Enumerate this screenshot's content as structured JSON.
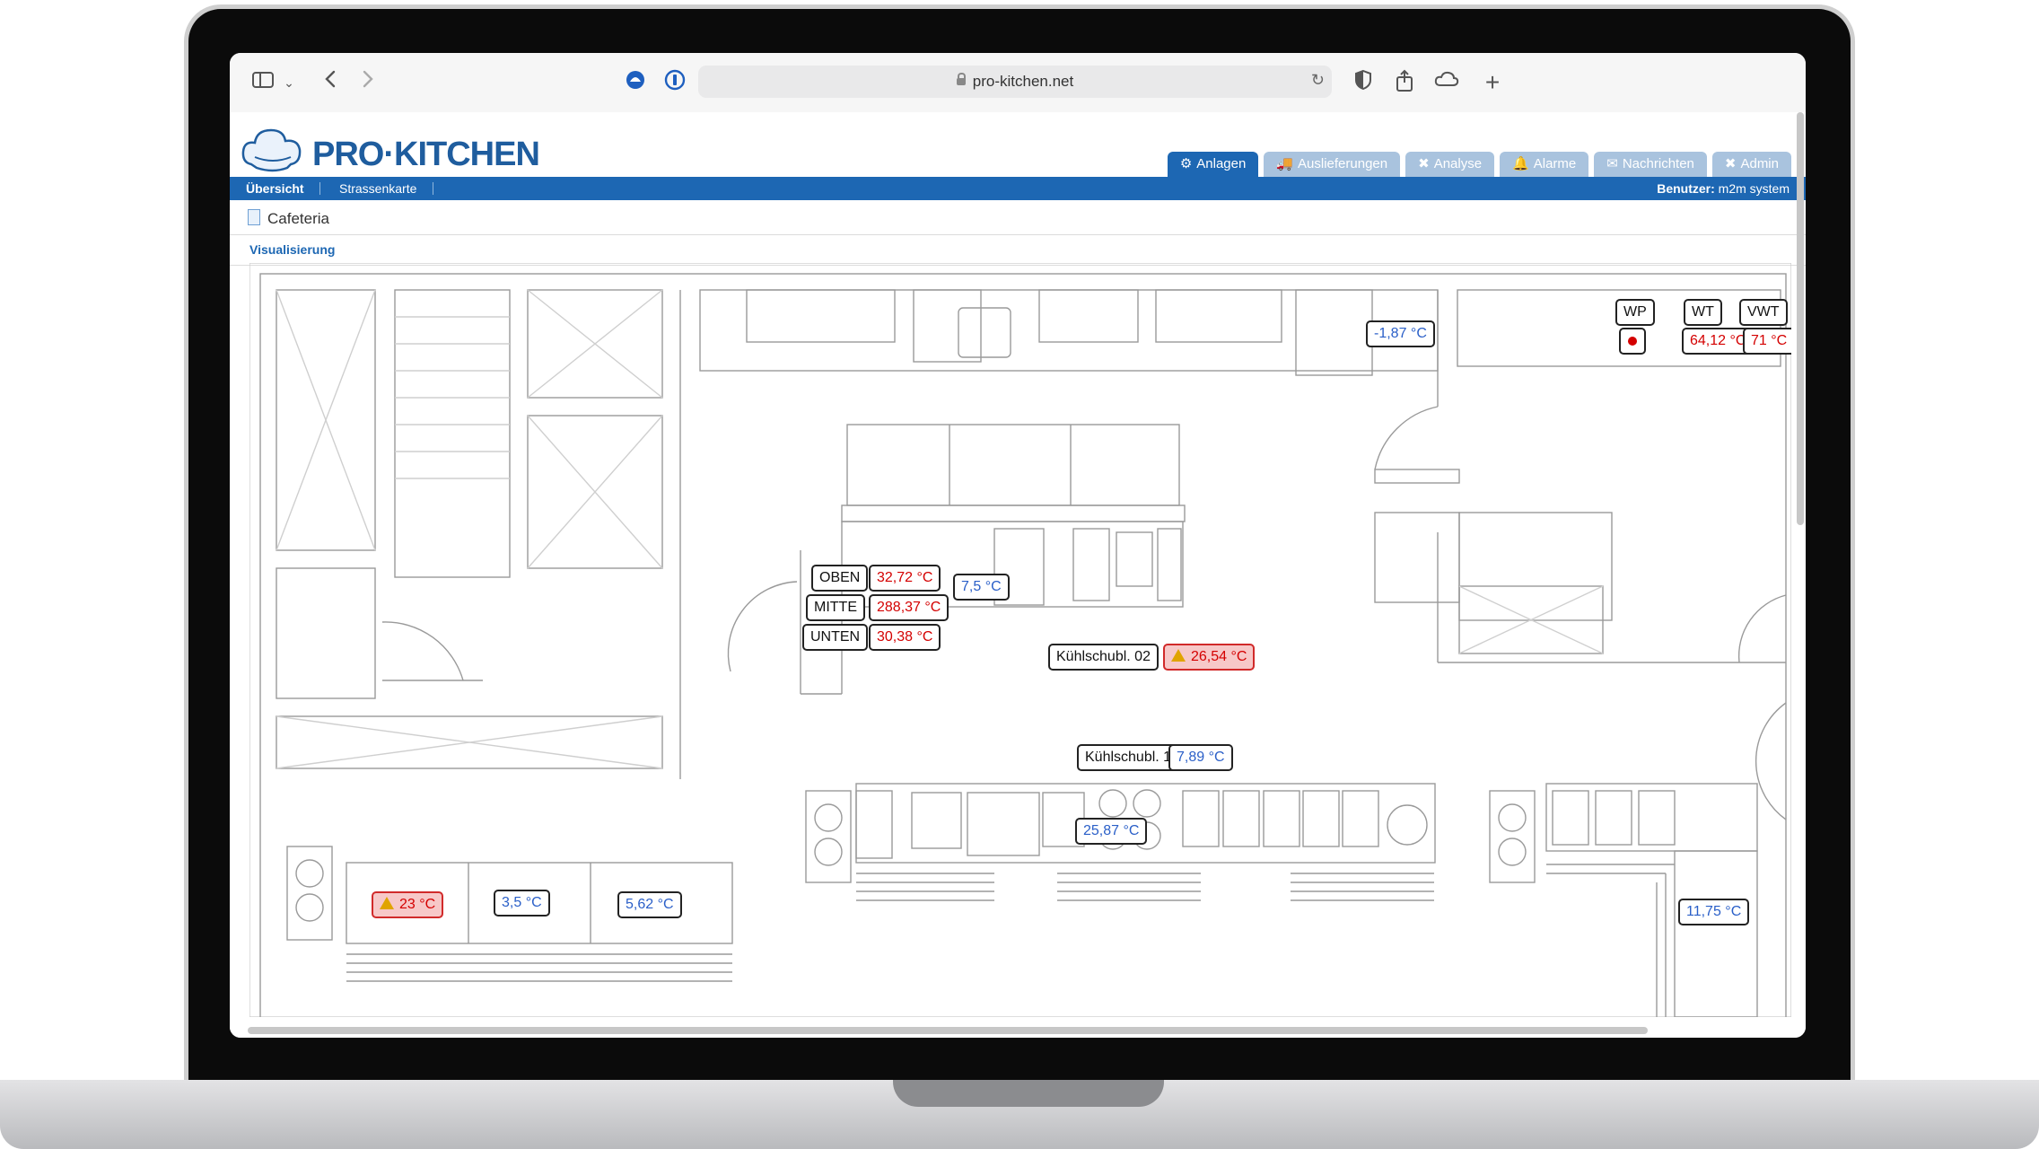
{
  "browser": {
    "url": "pro-kitchen.net",
    "icons": [
      "sidebar-icon",
      "chevron-down-icon",
      "back-icon",
      "forward-icon",
      "extension-blue-icon",
      "password-icon",
      "reload-icon",
      "shield-icon",
      "share-icon",
      "cloud-icon",
      "plus-icon"
    ]
  },
  "app": {
    "logo": "PRO·KITCHEN",
    "tabs": [
      {
        "label": "Anlagen",
        "icon": "gear-icon",
        "active": true
      },
      {
        "label": "Auslieferungen",
        "icon": "truck-icon",
        "active": false
      },
      {
        "label": "Analyse",
        "icon": "tools-icon",
        "active": false
      },
      {
        "label": "Alarme",
        "icon": "bell-icon",
        "active": false
      },
      {
        "label": "Nachrichten",
        "icon": "mail-icon",
        "active": false
      },
      {
        "label": "Admin",
        "icon": "wrench-icon",
        "active": false
      }
    ],
    "nav": [
      {
        "label": "Übersicht"
      },
      {
        "label": "Strassenkarte"
      }
    ],
    "user_label": "Benutzer:",
    "user_name": "m2m system",
    "breadcrumb": "Cafeteria",
    "subtab": "Visualisierung"
  },
  "sensors": {
    "oben_label": "OBEN",
    "oben_value": "32,72 °C",
    "mitte_label": "MITTE",
    "mitte_value": "288,37 °C",
    "unten_label": "UNTEN",
    "unten_value": "30,38 °C",
    "center_small": "7,5 °C",
    "ks02_label": "Kühlschubl. 02",
    "ks02_value": "26,54 °C",
    "ks1_label": "Kühlschubl. 1",
    "ks1_value": "7,89 °C",
    "mid_value": "25,87 °C",
    "cooler_value": "-1,87 °C",
    "wp_label": "WP",
    "wt_label": "WT",
    "wt_value": "64,12 °C",
    "vwt_label": "VWT",
    "vwt_value": "71 °C",
    "bl1_value": "23 °C",
    "bl2_value": "3,5 °C",
    "bl3_value": "5,62 °C",
    "br_value": "11,75 °C"
  },
  "colors": {
    "accent": "#1d67b3",
    "tab_inactive": "#a9c3de",
    "value_red": "#d40000",
    "value_blue": "#2a5fc8",
    "alarm_bg": "#f7c8c8"
  }
}
